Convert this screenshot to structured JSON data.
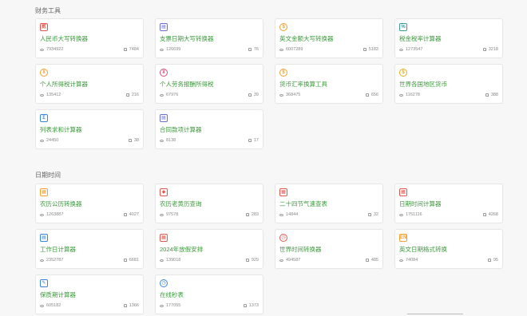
{
  "sections": [
    {
      "title": "财务工具",
      "cards": [
        {
          "name": "人民币大写转换器",
          "views": "7934922",
          "likes": "7484",
          "icon": "rmb-icon",
          "glyph": "贰",
          "color": "#e4574f"
        },
        {
          "name": "支票日期大写转换器",
          "views": "126699",
          "likes": "76",
          "icon": "check-icon",
          "glyph": "▤",
          "color": "#6b6fd4"
        },
        {
          "name": "英文金额大写转换器",
          "views": "6007289",
          "likes": "5183",
          "icon": "english-amount-icon",
          "glyph": "$",
          "color": "#f0a030"
        },
        {
          "name": "税金税率计算器",
          "views": "1273547",
          "likes": "3218",
          "icon": "tax-rate-icon",
          "glyph": "%",
          "color": "#3a9b9b"
        },
        {
          "name": "个人所得税计算器",
          "views": "135412",
          "likes": "216",
          "icon": "income-tax-icon",
          "glyph": "¥",
          "color": "#f0a030"
        },
        {
          "name": "个人劳务报酬所得税",
          "views": "67976",
          "likes": "39",
          "icon": "labor-tax-icon",
          "glyph": "¥",
          "color": "#d94a7a"
        },
        {
          "name": "货币汇率换算工具",
          "views": "368475",
          "likes": "656",
          "icon": "exchange-icon",
          "glyph": "$",
          "color": "#f0a030"
        },
        {
          "name": "世界各国地区货币",
          "views": "116278",
          "likes": "388",
          "icon": "world-currency-icon",
          "glyph": "$",
          "color": "#e0b020"
        },
        {
          "name": "列表求和计算器",
          "views": "24450",
          "likes": "38",
          "icon": "list-sum-icon",
          "glyph": "Σ",
          "color": "#3a86d4"
        },
        {
          "name": "合同款项计算器",
          "views": "8138",
          "likes": "17",
          "icon": "contract-icon",
          "glyph": "▤",
          "color": "#6b6fd4"
        }
      ]
    },
    {
      "title": "日期时间",
      "cards": [
        {
          "name": "农历公历转换器",
          "views": "1263887",
          "likes": "4027",
          "icon": "lunar-calendar-icon",
          "glyph": "▦",
          "color": "#f0a030"
        },
        {
          "name": "农历老黄历查询",
          "views": "97578",
          "likes": "283",
          "icon": "almanac-icon",
          "glyph": "◆",
          "color": "#e4574f"
        },
        {
          "name": "二十四节气速查表",
          "views": "14844",
          "likes": "32",
          "icon": "solar-terms-icon",
          "glyph": "▦",
          "color": "#e4574f"
        },
        {
          "name": "日期时间计算器",
          "views": "1751116",
          "likes": "4268",
          "icon": "datetime-calc-icon",
          "glyph": "▦",
          "color": "#e4574f"
        },
        {
          "name": "工作日计算器",
          "views": "2352787",
          "likes": "6681",
          "icon": "workday-icon",
          "glyph": "▤",
          "color": "#3a86d4"
        },
        {
          "name": "2024年放假安排",
          "views": "139018",
          "likes": "929",
          "icon": "holiday-icon",
          "glyph": "▦",
          "color": "#e4574f"
        },
        {
          "name": "世界时间转换器",
          "views": "494587",
          "likes": "485",
          "icon": "world-clock-icon",
          "glyph": "◷",
          "color": "#e4574f"
        },
        {
          "name": "英文日期格式转换",
          "views": "74084",
          "likes": "95",
          "icon": "en-date-icon",
          "glyph": "EN",
          "color": "#f0a030"
        },
        {
          "name": "保质期计算器",
          "views": "605182",
          "likes": "1366",
          "icon": "shelf-life-icon",
          "glyph": "✎",
          "color": "#3a86d4"
        },
        {
          "name": "在线秒表",
          "views": "177055",
          "likes": "1373",
          "icon": "stopwatch-icon",
          "glyph": "◷",
          "color": "#3a86d4"
        }
      ]
    }
  ]
}
